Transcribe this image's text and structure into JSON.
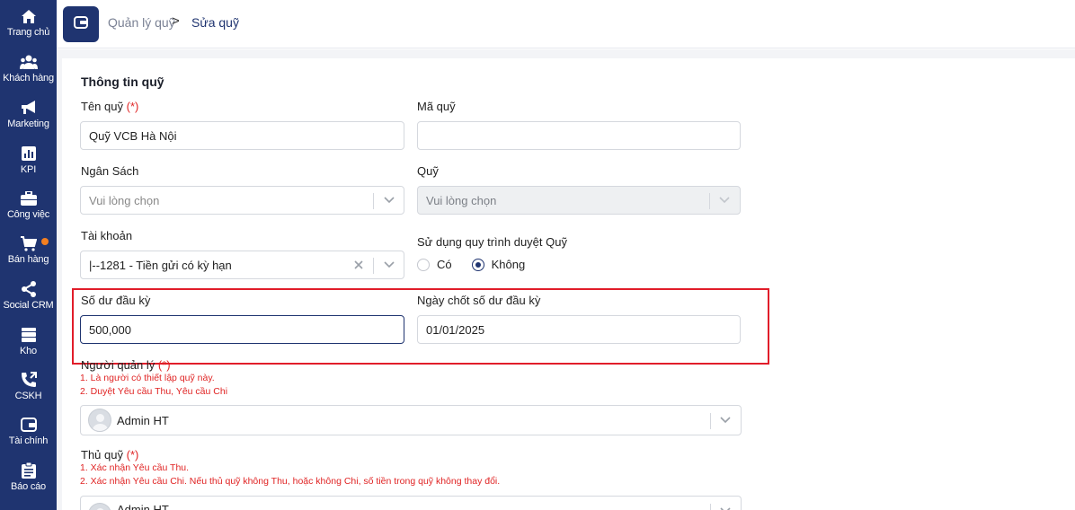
{
  "sidebar": {
    "items": [
      {
        "label": "Trang chủ",
        "icon": "home-icon"
      },
      {
        "label": "Khách hàng",
        "icon": "users-icon"
      },
      {
        "label": "Marketing",
        "icon": "megaphone-icon"
      },
      {
        "label": "KPI",
        "icon": "chart-icon"
      },
      {
        "label": "Công việc",
        "icon": "briefcase-icon"
      },
      {
        "label": "Bán hàng",
        "icon": "cart-icon"
      },
      {
        "label": "Social CRM",
        "icon": "share-icon"
      },
      {
        "label": "Kho",
        "icon": "warehouse-icon"
      },
      {
        "label": "CSKH",
        "icon": "phone-icon"
      },
      {
        "label": "Tài chính",
        "icon": "wallet-icon"
      },
      {
        "label": "Báo cáo",
        "icon": "clipboard-icon"
      }
    ],
    "notification_color": "#f47f20"
  },
  "breadcrumb": {
    "parent": "Quản lý quỹ",
    "separator": ">",
    "current": "Sửa quỹ"
  },
  "form": {
    "section_title": "Thông tin quỹ",
    "required_mark": "(*)",
    "fund_name": {
      "label": "Tên quỹ",
      "value": "Quỹ VCB Hà Nội"
    },
    "fund_code": {
      "label": "Mã quỹ",
      "value": ""
    },
    "budget": {
      "label": "Ngân Sách",
      "placeholder": "Vui lòng chọn"
    },
    "fund": {
      "label": "Quỹ",
      "placeholder": "Vui lòng chọn"
    },
    "account": {
      "label": "Tài khoản",
      "value": "|--1281 - Tiền gửi có kỳ hạn"
    },
    "approval": {
      "label": "Sử dụng quy trình duyệt Quỹ",
      "options": [
        "Có",
        "Không"
      ],
      "selected": "Không"
    },
    "opening_balance": {
      "label": "Số dư đầu kỳ",
      "value": "500,000"
    },
    "closing_date": {
      "label": "Ngày chốt số dư đầu kỳ",
      "value": "01/01/2025"
    },
    "manager": {
      "label": "Người quản lý",
      "notes": [
        "1. Là người có thiết lập quỹ này.",
        "2. Duyệt Yêu cầu Thu, Yêu cầu Chi"
      ],
      "value": "Admin HT"
    },
    "treasurer": {
      "label": "Thủ quỹ",
      "notes": [
        "1. Xác nhận Yêu cầu Thu.",
        "2. Xác nhận Yêu cầu Chi. Nếu thủ quỹ không Thu, hoặc không Chi, số tiền trong quỹ không thay đổi."
      ],
      "value": "Admin HT"
    }
  },
  "colors": {
    "brand": "#1f3470",
    "highlight": "#e11d2a",
    "required": "#e02424"
  }
}
